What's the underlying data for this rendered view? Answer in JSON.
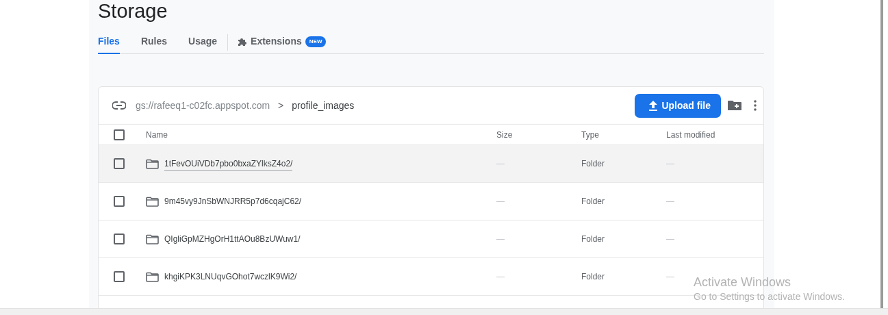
{
  "page": {
    "title": "Storage"
  },
  "tabs": [
    {
      "label": "Files",
      "selected": true
    },
    {
      "label": "Rules",
      "selected": false
    },
    {
      "label": "Usage",
      "selected": false
    },
    {
      "label": "Extensions",
      "selected": false,
      "badge": "NEW"
    }
  ],
  "breadcrumb": {
    "bucket": "gs://rafeeq1-c02fc.appspot.com",
    "separator": ">",
    "folder": "profile_images"
  },
  "toolbar": {
    "upload_button": "Upload file"
  },
  "table": {
    "columns": [
      "Name",
      "Size",
      "Type",
      "Last modified"
    ],
    "select_all_checked": false,
    "rows": [
      {
        "name": "1tFevOUiVDb7pbo0bxaZYlksZ4o2/",
        "size": "—",
        "type": "Folder",
        "modified": "—",
        "checked": false,
        "hovered": true
      },
      {
        "name": "9m45vy9JnSbWNJRR5p7d6cqajC62/",
        "size": "—",
        "type": "Folder",
        "modified": "—",
        "checked": false,
        "hovered": false
      },
      {
        "name": "QIgliGpMZHgOrH1ttAOu8BzUWuw1/",
        "size": "—",
        "type": "Folder",
        "modified": "—",
        "checked": false,
        "hovered": false
      },
      {
        "name": "khgiKPK3LNUqvGOhot7wczlK9Wi2/",
        "size": "—",
        "type": "Folder",
        "modified": "—",
        "checked": false,
        "hovered": false
      }
    ]
  },
  "os_notice": {
    "title": "Activate Windows",
    "message": "Go to Settings to activate Windows."
  }
}
